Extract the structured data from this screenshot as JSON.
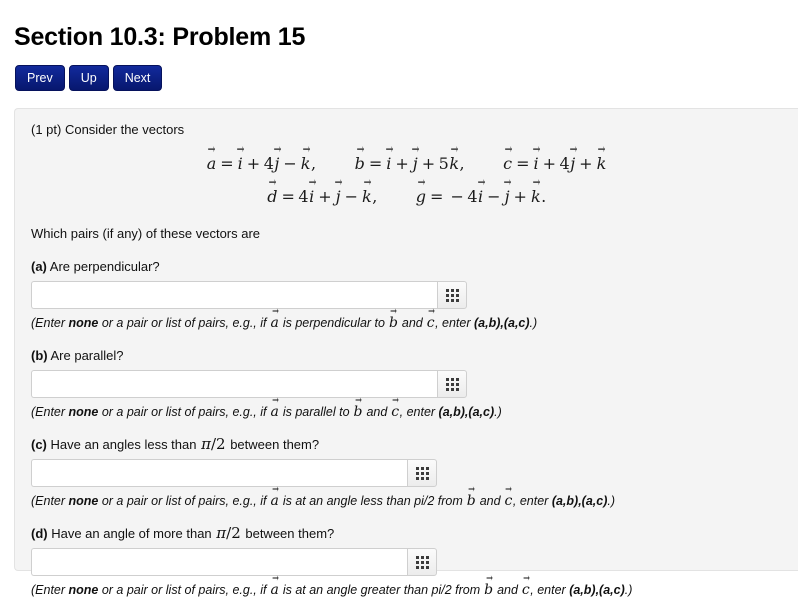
{
  "page": {
    "title": "Section 10.3: Problem 15"
  },
  "nav": {
    "buttons": [
      {
        "label": "Prev",
        "name": "prev-button"
      },
      {
        "label": "Up",
        "name": "up-button"
      },
      {
        "label": "Next",
        "name": "next-button"
      }
    ]
  },
  "problem": {
    "points_line": "(1 pt) Consider the vectors",
    "which_line": "Which pairs (if any) of these vectors are",
    "equations": {
      "row1": [
        {
          "lhs": "a",
          "terms": [
            {
              "op": "",
              "num": "",
              "unit": "i"
            },
            {
              "op": "+",
              "num": "4",
              "unit": "j"
            },
            {
              "op": "−",
              "num": "",
              "unit": "k"
            }
          ],
          "trailing": ","
        },
        {
          "lhs": "b",
          "terms": [
            {
              "op": "",
              "num": "",
              "unit": "i"
            },
            {
              "op": "+",
              "num": "",
              "unit": "j"
            },
            {
              "op": "+",
              "num": "5",
              "unit": "k"
            }
          ],
          "trailing": ","
        },
        {
          "lhs": "c",
          "terms": [
            {
              "op": "",
              "num": "",
              "unit": "i"
            },
            {
              "op": "+",
              "num": "4",
              "unit": "j"
            },
            {
              "op": "+",
              "num": "",
              "unit": "k"
            }
          ],
          "trailing": ""
        }
      ],
      "row2": [
        {
          "lhs": "d",
          "terms": [
            {
              "op": "",
              "num": "4",
              "unit": "i"
            },
            {
              "op": "+",
              "num": "",
              "unit": "j"
            },
            {
              "op": "−",
              "num": "",
              "unit": "k"
            }
          ],
          "trailing": ","
        },
        {
          "lhs": "g",
          "terms": [
            {
              "op": "−",
              "num": "4",
              "unit": "i"
            },
            {
              "op": "−",
              "num": "",
              "unit": "j"
            },
            {
              "op": "+",
              "num": "",
              "unit": "k"
            }
          ],
          "trailing": "."
        }
      ]
    },
    "questions": [
      {
        "id": "a",
        "tag": "(a)",
        "text": " Are perpendicular?",
        "has_pi": false,
        "input_value": "",
        "input_placeholder": "",
        "input_width": 406,
        "hint_pre": "(Enter ",
        "hint_none": "none",
        "hint_mid": " or a pair or list of pairs, e.g., if ",
        "hint_vec1": "a",
        "hint_rel": " is perpendicular to ",
        "hint_vec2": "b",
        "hint_and": " and ",
        "hint_vec3": "c",
        "hint_enter": ", enter ",
        "hint_answer": "(a,b),(a,c)",
        "hint_post": ".)"
      },
      {
        "id": "b",
        "tag": "(b)",
        "text": " Are parallel?",
        "has_pi": false,
        "input_value": "",
        "input_placeholder": "",
        "input_width": 406,
        "hint_pre": "(Enter ",
        "hint_none": "none",
        "hint_mid": " or a pair or list of pairs, e.g., if ",
        "hint_vec1": "a",
        "hint_rel": " is parallel to ",
        "hint_vec2": "b",
        "hint_and": " and ",
        "hint_vec3": "c",
        "hint_enter": ", enter ",
        "hint_answer": "(a,b),(a,c)",
        "hint_post": ".)"
      },
      {
        "id": "c",
        "tag": "(c)",
        "text_before_pi": " Have an angles less than ",
        "pi_expr": "π/2",
        "text_after_pi": " between them?",
        "has_pi": true,
        "input_value": "",
        "input_placeholder": "",
        "input_width": 376,
        "hint_pre": "(Enter ",
        "hint_none": "none",
        "hint_mid": " or a pair or list of pairs, e.g., if ",
        "hint_vec1": "a",
        "hint_rel": " is at an angle less than pi/2 from ",
        "hint_vec2": "b",
        "hint_and": " and ",
        "hint_vec3": "c",
        "hint_enter": ", enter ",
        "hint_answer": "(a,b),(a,c)",
        "hint_post": ".)"
      },
      {
        "id": "d",
        "tag": "(d)",
        "text_before_pi": " Have an angle of more than ",
        "pi_expr": "π/2",
        "text_after_pi": " between them?",
        "has_pi": true,
        "input_value": "",
        "input_placeholder": "",
        "input_width": 376,
        "hint_pre": "(Enter ",
        "hint_none": "none",
        "hint_mid": " or a pair or list of pairs, e.g., if ",
        "hint_vec1": "a",
        "hint_rel": " is at an angle greater than pi/2 from ",
        "hint_vec2": "b",
        "hint_and": " and ",
        "hint_vec3": "c",
        "hint_enter": ", enter ",
        "hint_answer": "(a,b),(a,c)",
        "hint_post": ".)"
      }
    ]
  },
  "icons": {
    "calculator": "grid-3x3-icon"
  },
  "colors": {
    "nav_button_bg": "#0b1f8f",
    "panel_bg": "#f4f4f4",
    "panel_border": "#e3e3e3",
    "input_border": "#cfcfcf",
    "text": "#111111"
  }
}
